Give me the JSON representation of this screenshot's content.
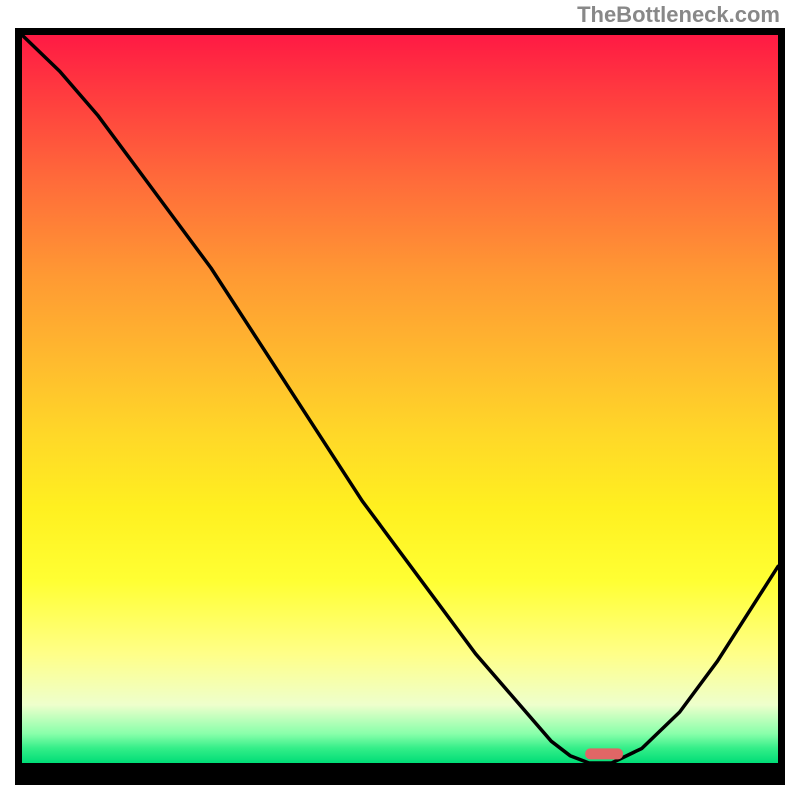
{
  "watermark": "TheBottleneck.com",
  "chart_data": {
    "type": "line",
    "title": "",
    "xlabel": "",
    "ylabel": "",
    "x": [
      0.0,
      0.05,
      0.1,
      0.15,
      0.2,
      0.25,
      0.3,
      0.35,
      0.4,
      0.45,
      0.5,
      0.55,
      0.6,
      0.65,
      0.7,
      0.725,
      0.75,
      0.78,
      0.82,
      0.87,
      0.92,
      1.0
    ],
    "values": [
      1.0,
      0.95,
      0.89,
      0.82,
      0.75,
      0.68,
      0.6,
      0.52,
      0.44,
      0.36,
      0.29,
      0.22,
      0.15,
      0.09,
      0.03,
      0.01,
      0.0,
      0.0,
      0.02,
      0.07,
      0.14,
      0.27
    ],
    "xlim": [
      0,
      1
    ],
    "ylim": [
      0,
      1
    ],
    "marker": {
      "x_start": 0.745,
      "x_end": 0.795,
      "y": 0.005
    },
    "background_gradient": {
      "stops": [
        {
          "pos": 0.0,
          "color": "#ff1a44"
        },
        {
          "pos": 0.5,
          "color": "#ffd828"
        },
        {
          "pos": 0.85,
          "color": "#ffff88"
        },
        {
          "pos": 1.0,
          "color": "#00dd77"
        }
      ],
      "direction": "top-to-bottom"
    }
  }
}
